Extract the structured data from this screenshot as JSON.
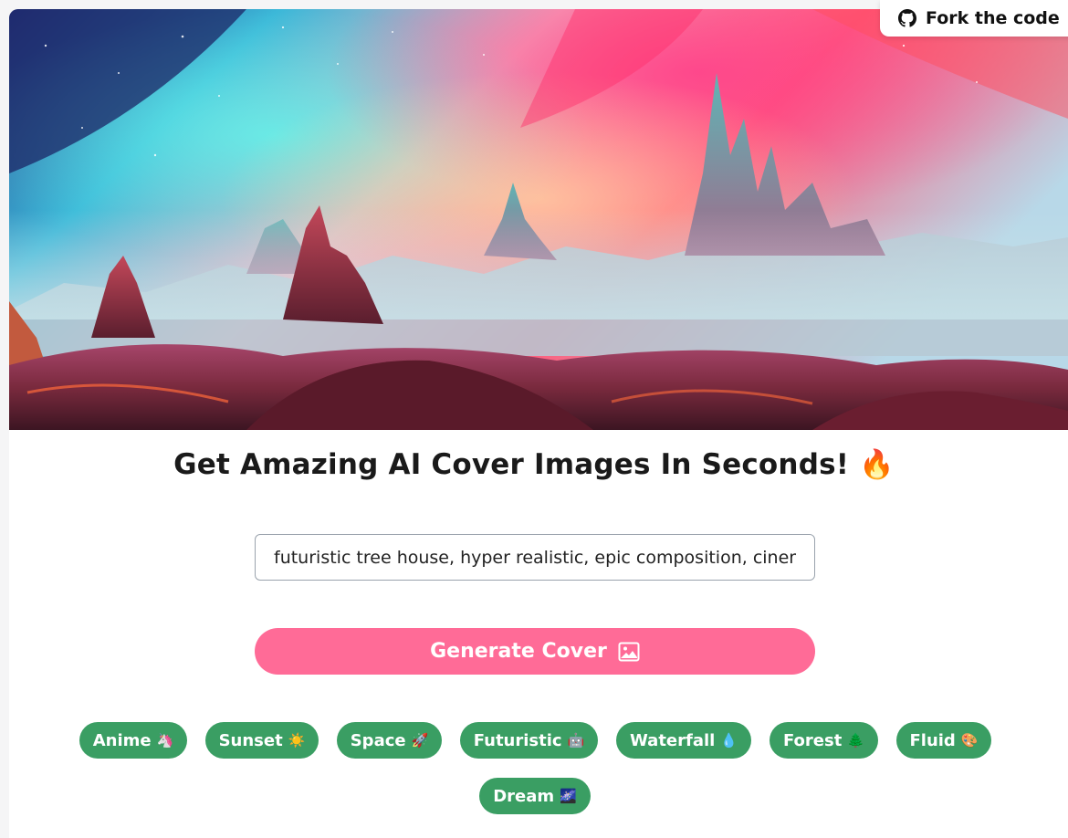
{
  "fork_link": {
    "label": "Fork the code",
    "icon": "github-icon"
  },
  "hero": {
    "icon": "fantasy-landscape-image"
  },
  "headline": {
    "text": "Get Amazing AI Cover Images In Seconds!",
    "emoji": "🔥"
  },
  "prompt_input": {
    "value": "futuristic tree house, hyper realistic, epic composition, cinematic"
  },
  "generate_button": {
    "label": "Generate Cover",
    "icon": "image-icon"
  },
  "style_tags": [
    {
      "label": "Anime",
      "emoji": "🦄"
    },
    {
      "label": "Sunset",
      "emoji": "☀️"
    },
    {
      "label": "Space",
      "emoji": "🚀"
    },
    {
      "label": "Futuristic",
      "emoji": "🤖"
    },
    {
      "label": "Waterfall",
      "emoji": "💧"
    },
    {
      "label": "Forest",
      "emoji": "🌲"
    },
    {
      "label": "Fluid",
      "emoji": "🎨"
    },
    {
      "label": "Dream",
      "emoji": "🌌"
    }
  ],
  "colors": {
    "accent_pink": "#ff6b97",
    "tag_green": "#3a9e63"
  }
}
